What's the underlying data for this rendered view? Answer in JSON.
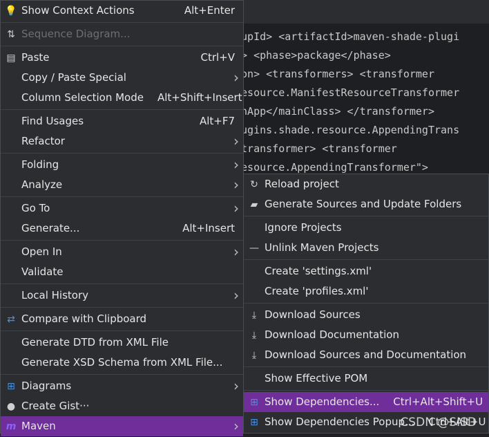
{
  "code_lines": [
    "oupId> <artifactId>maven-shade-plugi",
    "n> <phase>package</phase>",
    "ion> <transformers> <transformer",
    "resource.ManifestResourceTransformer",
    "inApp</mainClass> </transformer>",
    "lugins.shade.resource.AppendingTrans",
    "/transformer> <transformer",
    "resource.AppendingTransformer\">"
  ],
  "main_menu": [
    {
      "icon": "lightbulb-icon",
      "label": "Show Context Actions",
      "shortcut": "Alt+Enter"
    },
    {
      "sep": true
    },
    {
      "icon": "sequence-diagram-icon",
      "label": "Sequence Diagram...",
      "disabled": true
    },
    {
      "sep": true
    },
    {
      "icon": "clipboard-icon",
      "label": "Paste",
      "shortcut": "Ctrl+V"
    },
    {
      "label": "Copy / Paste Special",
      "submenu": true
    },
    {
      "label": "Column Selection Mode",
      "shortcut": "Alt+Shift+Insert"
    },
    {
      "sep": true
    },
    {
      "label": "Find Usages",
      "shortcut": "Alt+F7"
    },
    {
      "label": "Refactor",
      "submenu": true
    },
    {
      "sep": true
    },
    {
      "label": "Folding",
      "submenu": true
    },
    {
      "label": "Analyze",
      "submenu": true
    },
    {
      "sep": true
    },
    {
      "label": "Go To",
      "submenu": true
    },
    {
      "label": "Generate...",
      "shortcut": "Alt+Insert"
    },
    {
      "sep": true
    },
    {
      "label": "Open In",
      "submenu": true
    },
    {
      "label": "Validate"
    },
    {
      "sep": true
    },
    {
      "label": "Local History",
      "submenu": true
    },
    {
      "sep": true
    },
    {
      "icon": "compare-icon",
      "label": "Compare with Clipboard"
    },
    {
      "sep": true
    },
    {
      "label": "Generate DTD from XML File"
    },
    {
      "label": "Generate XSD Schema from XML File..."
    },
    {
      "sep": true
    },
    {
      "icon": "diagrams-icon",
      "label": "Diagrams",
      "submenu": true
    },
    {
      "icon": "github-icon",
      "label": "Create Gist···"
    },
    {
      "icon": "maven-icon",
      "label": "Maven",
      "submenu": true,
      "selected": true
    }
  ],
  "maven_menu": [
    {
      "icon": "reload-icon",
      "label": "Reload project"
    },
    {
      "icon": "folder-sync-icon",
      "label": "Generate Sources and Update Folders"
    },
    {
      "sep": true
    },
    {
      "label": "Ignore Projects"
    },
    {
      "icon": "minus-icon",
      "label": "Unlink Maven Projects"
    },
    {
      "sep": true
    },
    {
      "label": "Create 'settings.xml'"
    },
    {
      "label": "Create 'profiles.xml'"
    },
    {
      "sep": true
    },
    {
      "icon": "download-icon",
      "label": "Download Sources"
    },
    {
      "icon": "download-icon",
      "label": "Download Documentation"
    },
    {
      "icon": "download-icon",
      "label": "Download Sources and Documentation"
    },
    {
      "sep": true
    },
    {
      "label": "Show Effective POM"
    },
    {
      "sep": true
    },
    {
      "icon": "dependencies-icon",
      "label": "Show Dependencies...",
      "shortcut": "Ctrl+Alt+Shift+U",
      "selected": true
    },
    {
      "icon": "dependencies-icon",
      "label": "Show Dependencies Popup...",
      "shortcut": "Ctrl+Alt+U"
    }
  ],
  "watermark": "CSDN @SISD",
  "colors": {
    "selected": "#6f2e9a",
    "menu_bg": "#2b2d30",
    "editor_bg": "#1e1f22"
  }
}
